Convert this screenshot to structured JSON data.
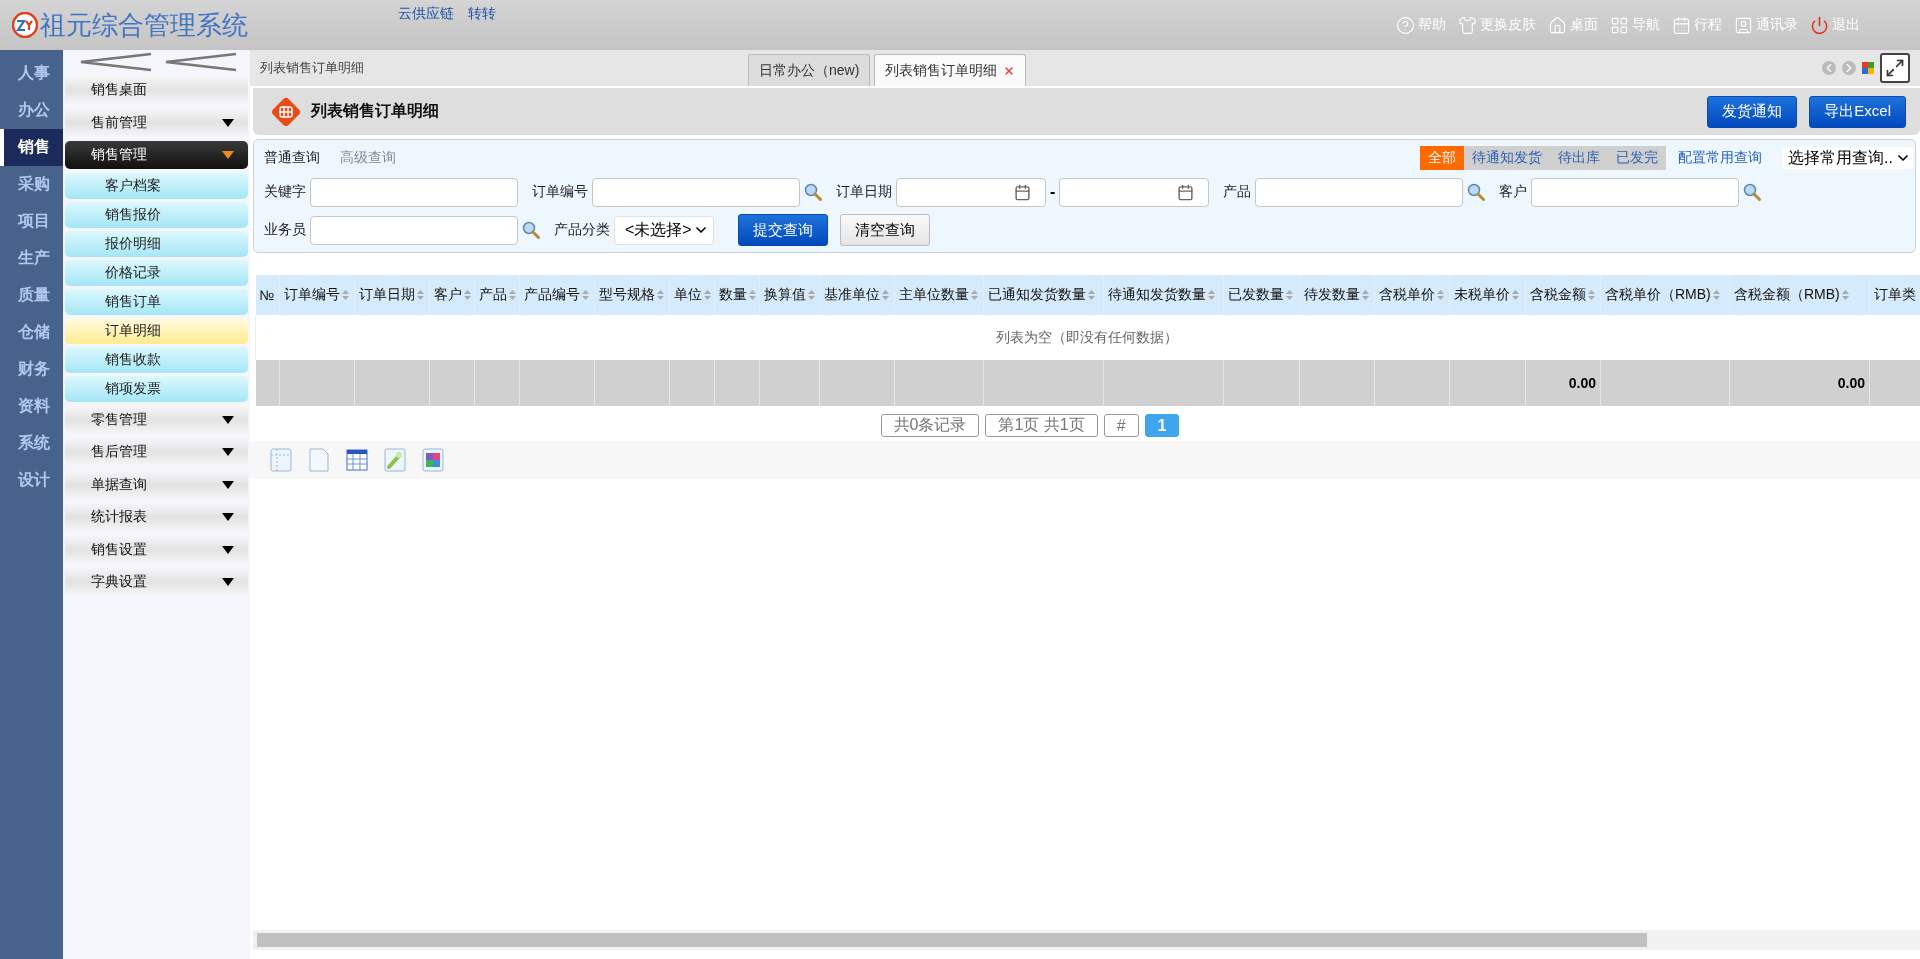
{
  "header": {
    "app_title": "祖元综合管理系统",
    "links": [
      "云供应链",
      "转转"
    ],
    "actions": [
      {
        "label": "帮助",
        "kind": "help"
      },
      {
        "label": "更换皮肤",
        "kind": "skin"
      },
      {
        "label": "桌面",
        "kind": "desktop"
      },
      {
        "label": "导航",
        "kind": "nav"
      },
      {
        "label": "行程",
        "kind": "schedule"
      },
      {
        "label": "通讯录",
        "kind": "contacts"
      },
      {
        "label": "退出",
        "kind": "logout"
      }
    ]
  },
  "modules": [
    {
      "label": "人事",
      "selected": false
    },
    {
      "label": "办公",
      "selected": false
    },
    {
      "label": "销售",
      "selected": true
    },
    {
      "label": "采购",
      "selected": false
    },
    {
      "label": "项目",
      "selected": false
    },
    {
      "label": "生产",
      "selected": false
    },
    {
      "label": "质量",
      "selected": false
    },
    {
      "label": "仓储",
      "selected": false
    },
    {
      "label": "财务",
      "selected": false
    },
    {
      "label": "资料",
      "selected": false
    },
    {
      "label": "系统",
      "selected": false
    },
    {
      "label": "设计",
      "selected": false
    }
  ],
  "sidebar": {
    "items": [
      {
        "label": "销售桌面",
        "kind": "link"
      },
      {
        "label": "售前管理",
        "kind": "group",
        "expanded": false
      },
      {
        "label": "销售管理",
        "kind": "group",
        "expanded": true,
        "children": [
          {
            "label": "客户档案",
            "selected": false
          },
          {
            "label": "销售报价",
            "selected": false
          },
          {
            "label": "报价明细",
            "selected": false
          },
          {
            "label": "价格记录",
            "selected": false
          },
          {
            "label": "销售订单",
            "selected": false
          },
          {
            "label": "订单明细",
            "selected": true
          },
          {
            "label": "销售收款",
            "selected": false
          },
          {
            "label": "销项发票",
            "selected": false
          }
        ]
      },
      {
        "label": "零售管理",
        "kind": "group",
        "expanded": false
      },
      {
        "label": "售后管理",
        "kind": "group",
        "expanded": false
      },
      {
        "label": "单据查询",
        "kind": "group",
        "expanded": false
      },
      {
        "label": "统计报表",
        "kind": "group",
        "expanded": false
      },
      {
        "label": "销售设置",
        "kind": "group",
        "expanded": false
      },
      {
        "label": "字典设置",
        "kind": "group",
        "expanded": false
      }
    ]
  },
  "breadcrumb": "列表销售订单明细",
  "tabs": [
    {
      "label": "日常办公（new)",
      "selected": false,
      "closable": false
    },
    {
      "label": "列表销售订单明细",
      "selected": true,
      "closable": true
    }
  ],
  "page": {
    "title": "列表销售订单明细",
    "buttons": [
      "发货通知",
      "导出Excel"
    ]
  },
  "query": {
    "modes": [
      {
        "label": "普通查询",
        "selected": true
      },
      {
        "label": "高级查询",
        "selected": false
      }
    ],
    "status_filters": [
      {
        "label": "全部",
        "selected": true
      },
      {
        "label": "待通知发货",
        "selected": false
      },
      {
        "label": "待出库",
        "selected": false
      },
      {
        "label": "已发完",
        "selected": false
      }
    ],
    "config_link": "配置常用查询",
    "saved_query": {
      "value": "选择常用查询.."
    },
    "rows": [
      {
        "fields": [
          {
            "label": "关键字",
            "kind": "text"
          },
          {
            "label": "订单编号",
            "kind": "lookup"
          },
          {
            "label": "订单日期",
            "kind": "daterange",
            "separator": "-"
          },
          {
            "label": "产品",
            "kind": "lookup"
          },
          {
            "label": "客户",
            "kind": "lookup"
          }
        ]
      },
      {
        "fields": [
          {
            "label": "业务员",
            "kind": "lookup"
          },
          {
            "label": "产品分类",
            "kind": "select",
            "value": "<未选择>"
          }
        ],
        "buttons": [
          {
            "label": "提交查询",
            "kind": "primary"
          },
          {
            "label": "清空查询",
            "kind": "secondary"
          }
        ]
      }
    ]
  },
  "table": {
    "columns": [
      {
        "label": "№",
        "sortable": false
      },
      {
        "label": "订单编号",
        "sortable": true
      },
      {
        "label": "订单日期",
        "sortable": true
      },
      {
        "label": "客户",
        "sortable": true
      },
      {
        "label": "产品",
        "sortable": true
      },
      {
        "label": "产品编号",
        "sortable": true
      },
      {
        "label": "型号规格",
        "sortable": true
      },
      {
        "label": "单位",
        "sortable": true
      },
      {
        "label": "数量",
        "sortable": true
      },
      {
        "label": "换算值",
        "sortable": true
      },
      {
        "label": "基准单位",
        "sortable": true
      },
      {
        "label": "主单位数量",
        "sortable": true
      },
      {
        "label": "已通知发货数量",
        "sortable": true
      },
      {
        "label": "待通知发货数量",
        "sortable": true
      },
      {
        "label": "已发数量",
        "sortable": true
      },
      {
        "label": "待发数量",
        "sortable": true
      },
      {
        "label": "含税单价",
        "sortable": true
      },
      {
        "label": "未税单价",
        "sortable": true
      },
      {
        "label": "含税金额",
        "sortable": true,
        "total": "0.00"
      },
      {
        "label": "含税单价（RMB)",
        "sortable": true
      },
      {
        "label": "含税金额（RMB)",
        "sortable": true,
        "total": "0.00"
      },
      {
        "label": "订单类",
        "sortable": false
      }
    ],
    "empty_message": "列表为空（即没有任何数据）"
  },
  "pager": [
    {
      "label": "共0条记录",
      "selected": false
    },
    {
      "label": "第1页 共1页",
      "selected": false
    },
    {
      "label": "#",
      "selected": false
    },
    {
      "label": "1",
      "selected": true
    }
  ]
}
